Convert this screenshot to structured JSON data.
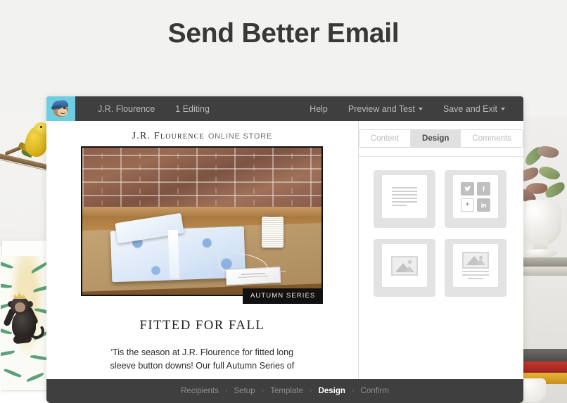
{
  "page": {
    "title": "Send Better Email",
    "background_color": "#f2f2f0"
  },
  "app": {
    "topbar": {
      "logo_icon": "mailchimp-freddie-icon",
      "logo_bg_color": "#6fcde2",
      "campaign_name": "J.R. Flourence",
      "editing_status": "1 Editing",
      "help_label": "Help",
      "preview_and_test_label": "Preview and Test",
      "save_and_exit_label": "Save and Exit",
      "bar_color": "#3f3f3f"
    },
    "preview": {
      "brand_name": "J.R. Flourence",
      "brand_subtitle": "ONLINE STORE",
      "hero_image_alt": "Folded blue patterned button-down shirt on kraft paper with twine spool and tag against a brick wall",
      "hero_badge": "AUTUMN SERIES",
      "headline": "FITTED FOR FALL",
      "body_text": "'Tis the season at J.R. Flourence for fitted long sleeve button downs! Our full Autumn Series of"
    },
    "sidebar": {
      "tabs": [
        {
          "label": "Content",
          "active": false
        },
        {
          "label": "Design",
          "active": true
        },
        {
          "label": "Comments",
          "active": false
        }
      ],
      "blocks": [
        {
          "name": "text-block",
          "icon": "text-lines-icon"
        },
        {
          "name": "social-share-block",
          "icon": "social-icons-icon"
        },
        {
          "name": "image-block",
          "icon": "image-icon"
        },
        {
          "name": "image-caption-block",
          "icon": "image-caption-icon"
        }
      ],
      "social_icons": [
        "twitter-icon",
        "facebook-icon",
        "plus-icon",
        "linkedin-icon"
      ]
    },
    "bottomnav": {
      "steps": [
        {
          "label": "Recipients",
          "active": false
        },
        {
          "label": "Setup",
          "active": false
        },
        {
          "label": "Template",
          "active": false
        },
        {
          "label": "Design",
          "active": true
        },
        {
          "label": "Confirm",
          "active": false
        }
      ],
      "separator": "›",
      "bar_color": "#3f3f3f"
    }
  },
  "background_scene": {
    "left_alt": "Yellow bird perched on a branch above a framed monkey illustration poster",
    "right_alt": "Succulent plant in a white ceramic footed vase resting on stacked books"
  }
}
